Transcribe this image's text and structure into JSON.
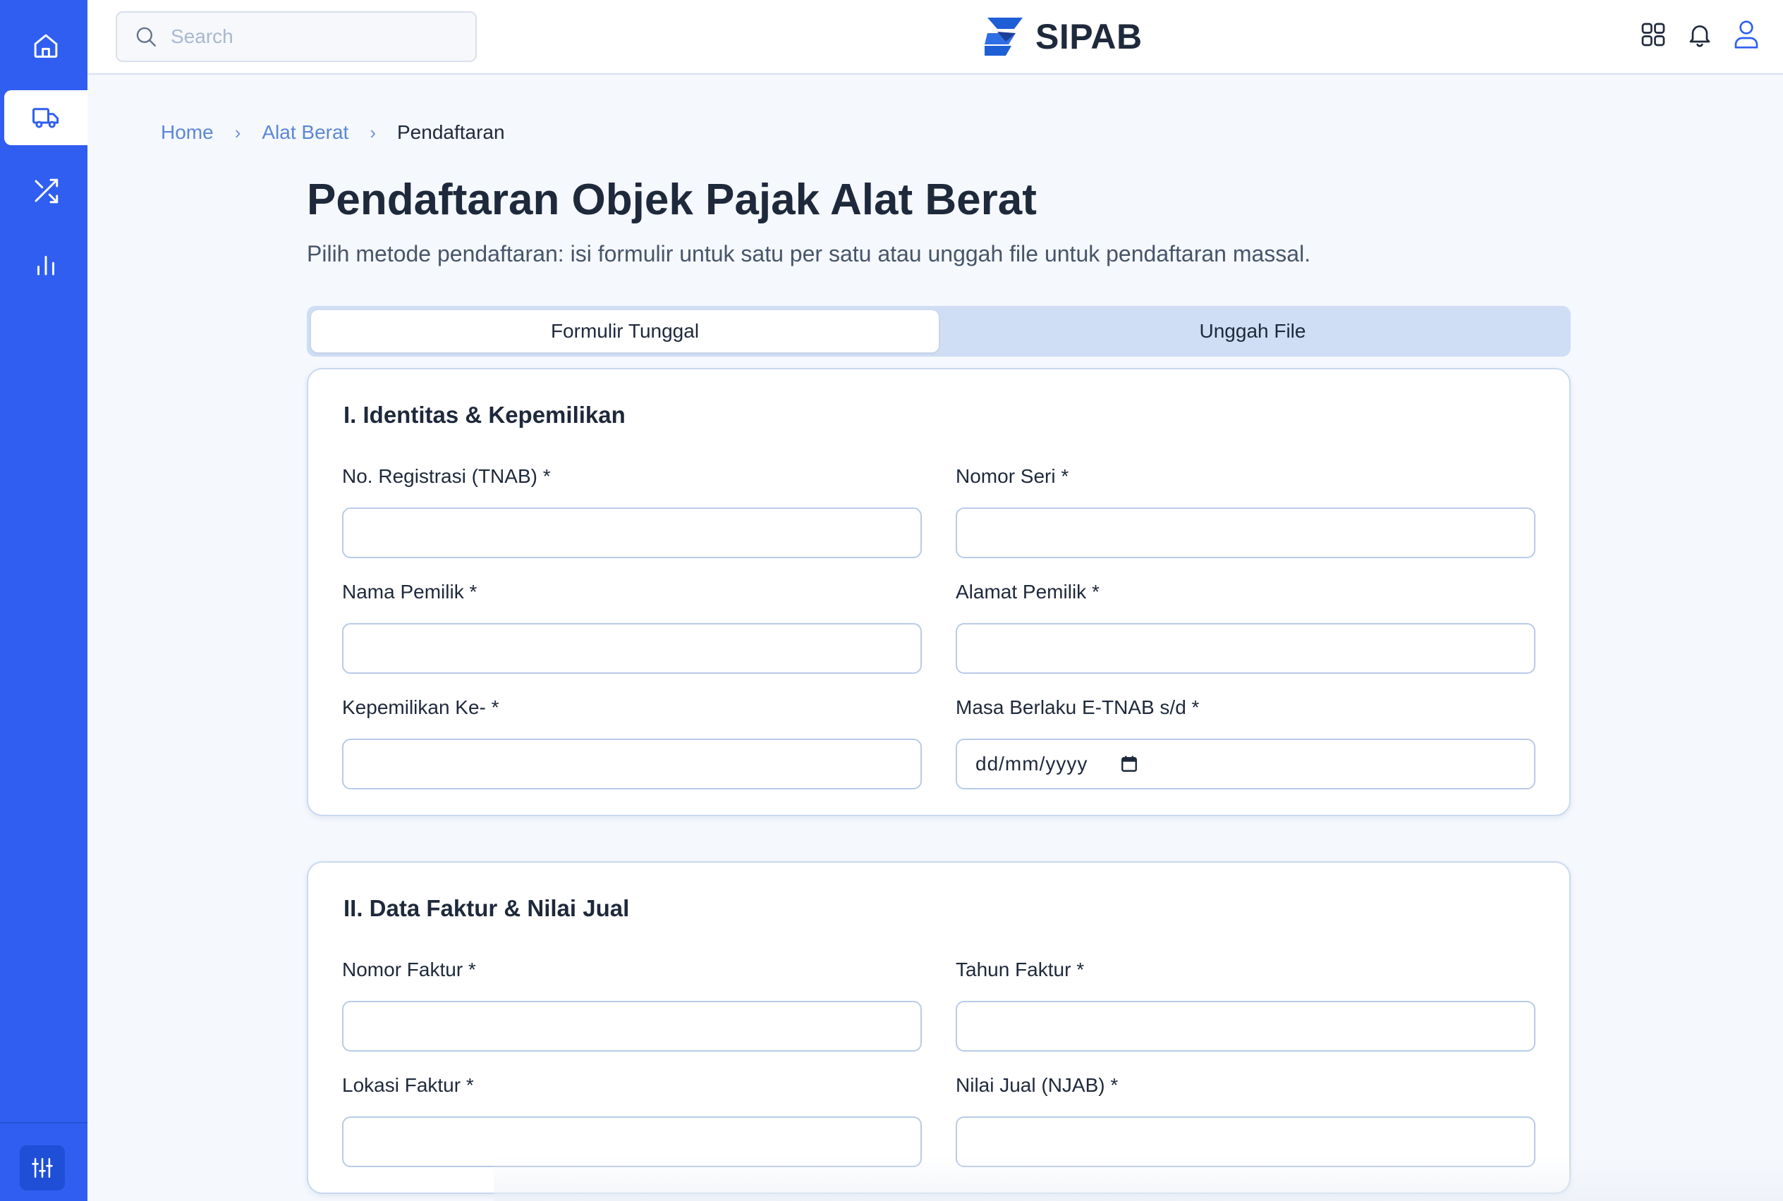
{
  "brand": {
    "name": "SIPAB"
  },
  "search": {
    "placeholder": "Search"
  },
  "sidebar": {
    "items": [
      {
        "icon": "home-icon",
        "active": false
      },
      {
        "icon": "truck-icon",
        "active": true
      },
      {
        "icon": "shuffle-icon",
        "active": false
      },
      {
        "icon": "bar-chart-icon",
        "active": false
      }
    ],
    "bottom_icon": "sliders-icon"
  },
  "topbar": {
    "icons": [
      "apps-grid-icon",
      "bell-icon",
      "user-icon"
    ]
  },
  "breadcrumb": {
    "home": "Home",
    "section": "Alat Berat",
    "current": "Pendaftaran",
    "separator": "›"
  },
  "page": {
    "title": "Pendaftaran Objek Pajak Alat Berat",
    "subtitle": "Pilih metode pendaftaran: isi formulir untuk satu per satu atau unggah file untuk pendaftaran massal."
  },
  "tabs": [
    {
      "label": "Formulir Tunggal",
      "active": true
    },
    {
      "label": "Unggah File",
      "active": false
    }
  ],
  "sections": [
    {
      "title": "I. Identitas & Kepemilikan",
      "fields": [
        {
          "label": "No. Registrasi (TNAB) *",
          "value": ""
        },
        {
          "label": "Nomor Seri *",
          "value": ""
        },
        {
          "label": "Nama Pemilik *",
          "value": ""
        },
        {
          "label": "Alamat Pemilik *",
          "value": ""
        },
        {
          "label": "Kepemilikan Ke- *",
          "value": ""
        },
        {
          "label": "Masa Berlaku E-TNAB s/d *",
          "value": "",
          "placeholder": "dd/mm/yyyy",
          "type": "date"
        }
      ]
    },
    {
      "title": "II. Data Faktur & Nilai Jual",
      "fields": [
        {
          "label": "Nomor Faktur *",
          "value": ""
        },
        {
          "label": "Tahun Faktur *",
          "value": ""
        },
        {
          "label": "Lokasi Faktur *",
          "value": ""
        },
        {
          "label": "Nilai Jual (NJAB) *",
          "value": ""
        }
      ]
    }
  ],
  "colors": {
    "sidebar": "#2f5ef0",
    "accent": "#2f5ef0",
    "tab_track": "#cfdef4",
    "input_border": "#b8cbe8"
  }
}
